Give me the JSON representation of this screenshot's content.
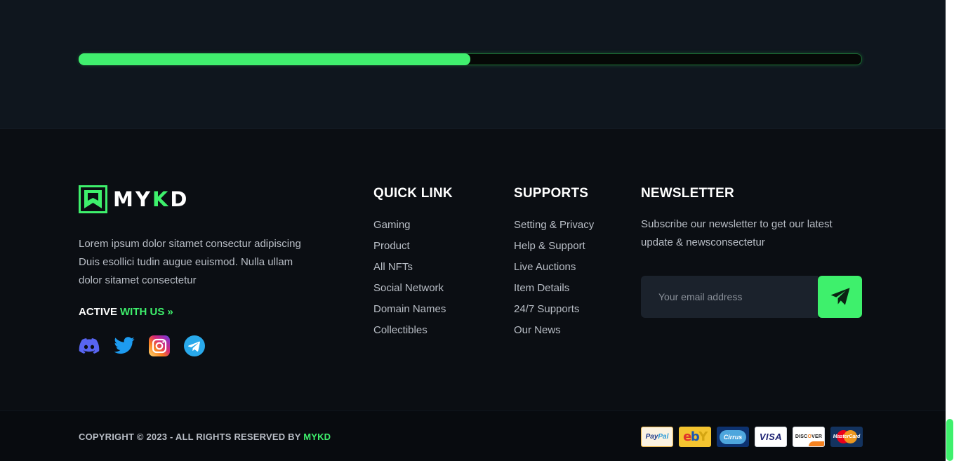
{
  "progress": {
    "value_percent": 50
  },
  "brand": {
    "name_prefix": "MY",
    "name_k": "K",
    "name_suffix": "D",
    "about": "Lorem ipsum dolor sitamet consectur adipiscing Duis esollici tudin augue euismod. Nulla ullam dolor sitamet consectetur"
  },
  "social": {
    "active_label": "ACTIVE",
    "with_us_label": "WITH US",
    "arrow": "»",
    "icons": [
      "discord-icon",
      "twitter-icon",
      "instagram-icon",
      "telegram-icon"
    ]
  },
  "quick_link": {
    "title": "QUICK LINK",
    "items": [
      "Gaming",
      "Product",
      "All NFTs",
      "Social Network",
      "Domain Names",
      "Collectibles"
    ]
  },
  "supports": {
    "title": "SUPPORTS",
    "items": [
      "Setting & Privacy",
      "Help & Support",
      "Live Auctions",
      "Item Details",
      "24/7 Supports",
      "Our News"
    ]
  },
  "newsletter": {
    "title": "NEWSLETTER",
    "text": "Subscribe our newsletter to get our latest update & newsconsectetur",
    "placeholder": "Your email address",
    "button_icon": "send-icon"
  },
  "copyright": {
    "text": "COPYRIGHT © 2023 - ALL RIGHTS RESERVED BY",
    "brand": "MYKD"
  },
  "payment_cards": [
    "PayPal",
    "ebY",
    "Cirrus",
    "VISA",
    "DISCOVER",
    "MasterCard"
  ],
  "colors": {
    "accent": "#3ef06c",
    "background": "#0b0e13",
    "top_band": "#0f161e"
  }
}
